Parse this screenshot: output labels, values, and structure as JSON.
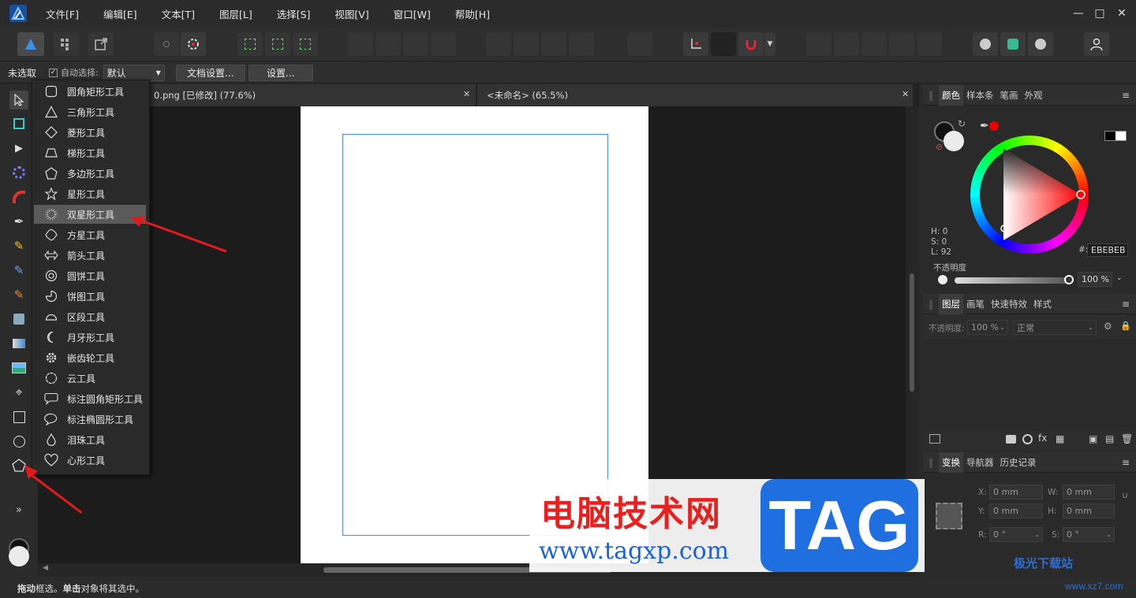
{
  "menubar": {
    "items": [
      "文件[F]",
      "编辑[E]",
      "文本[T]",
      "图层[L]",
      "选择[S]",
      "视图[V]",
      "窗口[W]",
      "帮助[H]"
    ],
    "window_controls": [
      "minimize",
      "maximize",
      "close"
    ]
  },
  "contextbar": {
    "selection_label": "未选取",
    "auto_select_label": "自动选择:",
    "auto_select_value": "默认",
    "doc_settings_button": "文档设置...",
    "settings_button": "设置..."
  },
  "tabs": [
    {
      "label": "0.png [已修改] (77.6%)"
    },
    {
      "label": "<未命名> (65.5%)"
    }
  ],
  "flyout": {
    "items": [
      {
        "label": "圆角矩形工具",
        "icon": "rounded-rect-icon"
      },
      {
        "label": "三角形工具",
        "icon": "triangle-icon"
      },
      {
        "label": "菱形工具",
        "icon": "diamond-icon"
      },
      {
        "label": "梯形工具",
        "icon": "trapezoid-icon"
      },
      {
        "label": "多边形工具",
        "icon": "polygon-icon"
      },
      {
        "label": "星形工具",
        "icon": "star-icon"
      },
      {
        "label": "双星形工具",
        "icon": "double-star-icon",
        "selected": true
      },
      {
        "label": "方星工具",
        "icon": "square-star-icon"
      },
      {
        "label": "箭头工具",
        "icon": "arrow-icon"
      },
      {
        "label": "圆饼工具",
        "icon": "donut-icon"
      },
      {
        "label": "饼图工具",
        "icon": "pie-icon"
      },
      {
        "label": "区段工具",
        "icon": "segment-icon"
      },
      {
        "label": "月牙形工具",
        "icon": "crescent-icon"
      },
      {
        "label": "嵌齿轮工具",
        "icon": "cog-icon"
      },
      {
        "label": "云工具",
        "icon": "cloud-icon"
      },
      {
        "label": "标注圆角矩形工具",
        "icon": "callout-rect-icon"
      },
      {
        "label": "标注椭圆形工具",
        "icon": "callout-ellipse-icon"
      },
      {
        "label": "泪珠工具",
        "icon": "teardrop-icon"
      },
      {
        "label": "心形工具",
        "icon": "heart-icon"
      }
    ]
  },
  "color_panel": {
    "tabs": [
      "颜色",
      "样本条",
      "笔画",
      "外观"
    ],
    "h": "H: 0",
    "s": "S: 0",
    "l": "L: 92",
    "hex_label": "#:",
    "hex_value": "EBEBEB",
    "opacity_label": "不透明度",
    "opacity_value": "100 %"
  },
  "layers_panel": {
    "tabs": [
      "图层",
      "画笔",
      "快速特效",
      "样式"
    ],
    "opacity_label": "不透明度:",
    "opacity_value": "100 %",
    "blend_mode": "正常"
  },
  "transform_panel": {
    "tabs": [
      "变换",
      "导航器",
      "历史记录"
    ],
    "x_label": "X:",
    "x_value": "0 mm",
    "y_label": "Y:",
    "y_value": "0 mm",
    "w_label": "W:",
    "w_value": "0 mm",
    "h_label": "H:",
    "h_value": "0 mm",
    "r_label": "R:",
    "r_value": "0 °",
    "s_label": "S:",
    "s_value": "0 °"
  },
  "statusbar": {
    "bold1": "拖动",
    "text1": " 框选。",
    "bold2": "单击",
    "text2": " 对象将其选中。"
  },
  "watermark": {
    "cn": "电脑技术网",
    "url": "www.tagxp.com",
    "tag": "TAG",
    "site2": "极光下载站",
    "site2_url": "www.xz7.com"
  },
  "colors": {
    "accent": "#1f6fe0",
    "arrow": "#e11b1b",
    "guide": "#4a90d9"
  }
}
